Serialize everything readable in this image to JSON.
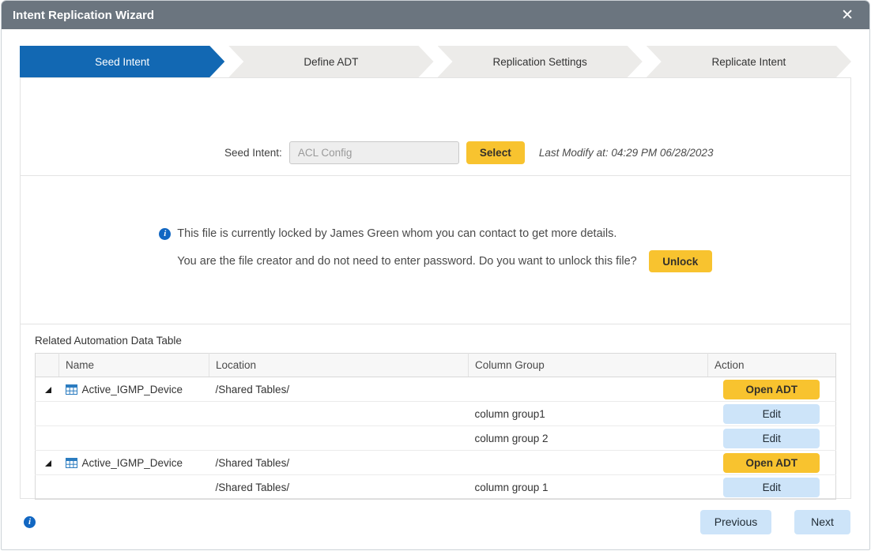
{
  "window": {
    "title": "Intent Replication Wizard"
  },
  "icons": {
    "close": "✕",
    "info": "i"
  },
  "colors": {
    "accent-blue": "#1268b3",
    "titlebar-gray": "#6b757f",
    "button-yellow": "#f8c32f",
    "button-light-blue": "#cde4f9",
    "info-blue": "#1267c2"
  },
  "steps": [
    {
      "label": "Seed Intent",
      "active": true
    },
    {
      "label": "Define ADT",
      "active": false
    },
    {
      "label": "Replication Settings",
      "active": false
    },
    {
      "label": "Replicate Intent",
      "active": false
    }
  ],
  "seed_intent": {
    "label": "Seed Intent:",
    "value": "ACL Config",
    "select_button": "Select",
    "last_modify": "Last Modify at: 04:29 PM 06/28/2023"
  },
  "lock_notice": {
    "line1": "This file is currently locked by James Green whom you can contact to get more details.",
    "line2": "You are the file creator and do not need to enter password. Do you want to unlock this file?",
    "unlock_button": "Unlock"
  },
  "adt_table": {
    "title": "Related Automation Data Table",
    "columns": [
      "",
      "Name",
      "Location",
      "Column Group",
      "Action"
    ],
    "rows": [
      {
        "expandable": true,
        "name": "Active_IGMP_Device",
        "location": "/Shared Tables/",
        "column_group": "",
        "action": "Open ADT"
      },
      {
        "expandable": false,
        "name": "",
        "location": "",
        "column_group": "column group1",
        "action": "Edit"
      },
      {
        "expandable": false,
        "name": "",
        "location": "",
        "column_group": "column group 2",
        "action": "Edit"
      },
      {
        "expandable": true,
        "name": "Active_IGMP_Device",
        "location": "/Shared Tables/",
        "column_group": "",
        "action": "Open ADT"
      },
      {
        "expandable": false,
        "name": "",
        "location": "/Shared Tables/",
        "column_group": "column group 1",
        "action": "Edit"
      }
    ]
  },
  "footer": {
    "previous_button": "Previous",
    "next_button": "Next"
  }
}
